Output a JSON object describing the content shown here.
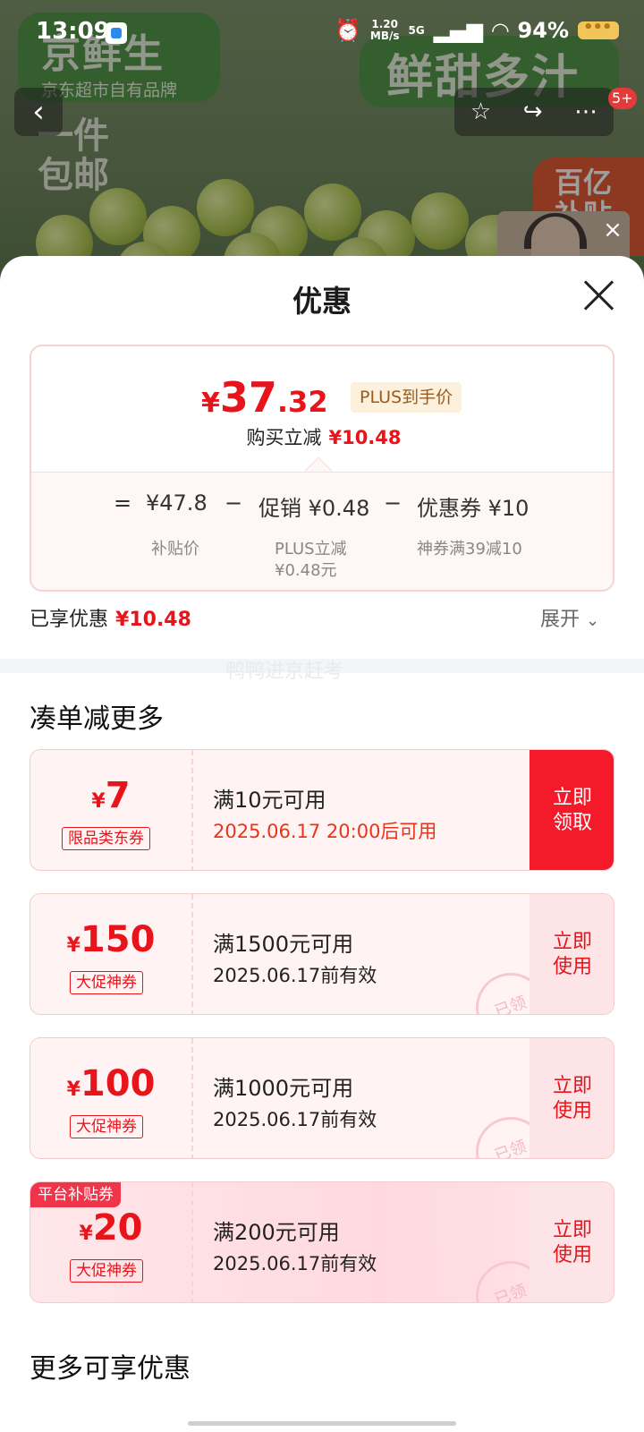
{
  "status_bar": {
    "time": "13:09",
    "net_speed": "1.20",
    "net_unit": "MB/s",
    "signal": "5G",
    "battery": "94%"
  },
  "background": {
    "brand": "京鲜生",
    "brand_sub": "京东超市自有品牌",
    "ship_line1": "一件",
    "ship_line2": "包邮",
    "slogan": "鲜甜多汁",
    "subsidy_line1": "百亿",
    "subsidy_line2": "补贴",
    "cart_badge": "5+"
  },
  "sheet": {
    "title": "优惠",
    "final_price": {
      "symbol": "¥",
      "integer": "37",
      "decimal": ".32"
    },
    "plus_tag": "PLUS到手价",
    "reduce_label": "购买立减",
    "reduce_value": "¥10.48",
    "formula": {
      "equals": "=",
      "base": "¥47.8",
      "base_caption": "补贴价",
      "minus1": "−",
      "promo": "促销 ¥0.48",
      "promo_caption1": "PLUS立减",
      "promo_caption2": "¥0.48元",
      "minus2": "−",
      "coupon": "优惠券 ¥10",
      "coupon_caption": "神券满39减10"
    },
    "saved_label": "已享优惠",
    "saved_value": "¥10.48",
    "expand_label": "展开",
    "watermark": "鸭鸭进京赶考",
    "section_more": "凑单减更多",
    "section_extra": "更多可享优惠"
  },
  "coupons": [
    {
      "symbol": "¥",
      "amount": "7",
      "tag": "限品类东券",
      "condition": "满10元可用",
      "validity": "2025.06.17 20:00后可用",
      "action_line1": "立即",
      "action_line2": "领取"
    },
    {
      "symbol": "¥",
      "amount": "150",
      "tag": "大促神券",
      "condition": "满1500元可用",
      "validity": "2025.06.17前有效",
      "action_line1": "立即",
      "action_line2": "使用",
      "stamp": "已领"
    },
    {
      "symbol": "¥",
      "amount": "100",
      "tag": "大促神券",
      "condition": "满1000元可用",
      "validity": "2025.06.17前有效",
      "action_line1": "立即",
      "action_line2": "使用",
      "stamp": "已领"
    },
    {
      "corner": "平台补贴券",
      "symbol": "¥",
      "amount": "20",
      "tag": "大促神券",
      "condition": "满200元可用",
      "validity": "2025.06.17前有效",
      "action_line1": "立即",
      "action_line2": "使用",
      "stamp": "已领"
    }
  ]
}
